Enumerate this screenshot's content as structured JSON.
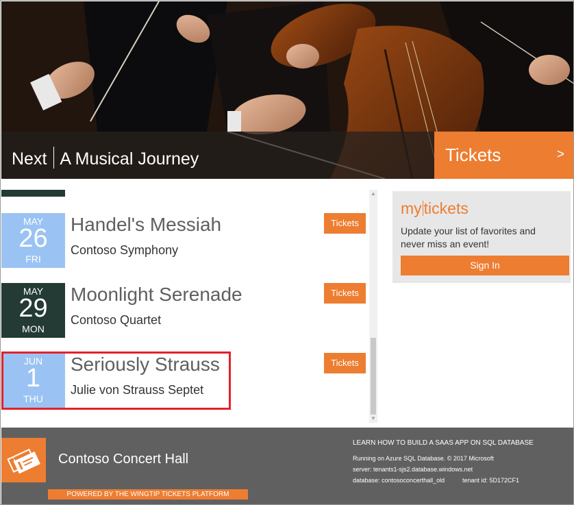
{
  "hero": {
    "next_label": "Next",
    "event_name": "A Musical Journey",
    "tickets_label": "Tickets",
    "arrow": ">"
  },
  "events": [
    {
      "month": "MAY",
      "day": "26",
      "weekday": "FRI",
      "title": "Handel's Messiah",
      "performer": "Contoso Symphony",
      "button": "Tickets",
      "color": "blue"
    },
    {
      "month": "MAY",
      "day": "29",
      "weekday": "MON",
      "title": "Moonlight Serenade",
      "performer": "Contoso Quartet",
      "button": "Tickets",
      "color": "dark"
    },
    {
      "month": "JUN",
      "day": "1",
      "weekday": "THU",
      "title": "Seriously Strauss",
      "performer": "Julie von Strauss Septet",
      "button": "Tickets",
      "color": "blue"
    }
  ],
  "mytickets": {
    "logo_my": "my",
    "logo_tickets": "tickets",
    "text": "Update your list of favorites and never miss an event!",
    "signin": "Sign In"
  },
  "footer": {
    "venue": "Contoso Concert Hall",
    "powered": "POWERED BY THE WINGTIP TICKETS PLATFORM",
    "learn": "LEARN HOW TO BUILD A SAAS APP ON SQL DATABASE",
    "running": "Running on Azure SQL Database. © 2017 Microsoft",
    "server": "server: tenants1-sjs2.database.windows.net",
    "database": "database: contosoconcerthall_old",
    "tenant": "tenant id: 5D172CF1"
  },
  "colors": {
    "accent": "#ed7d31",
    "date_blue": "#9ac3f3",
    "date_dark": "#233a35",
    "footer_bg": "#606060",
    "highlight": "#e4202a"
  }
}
